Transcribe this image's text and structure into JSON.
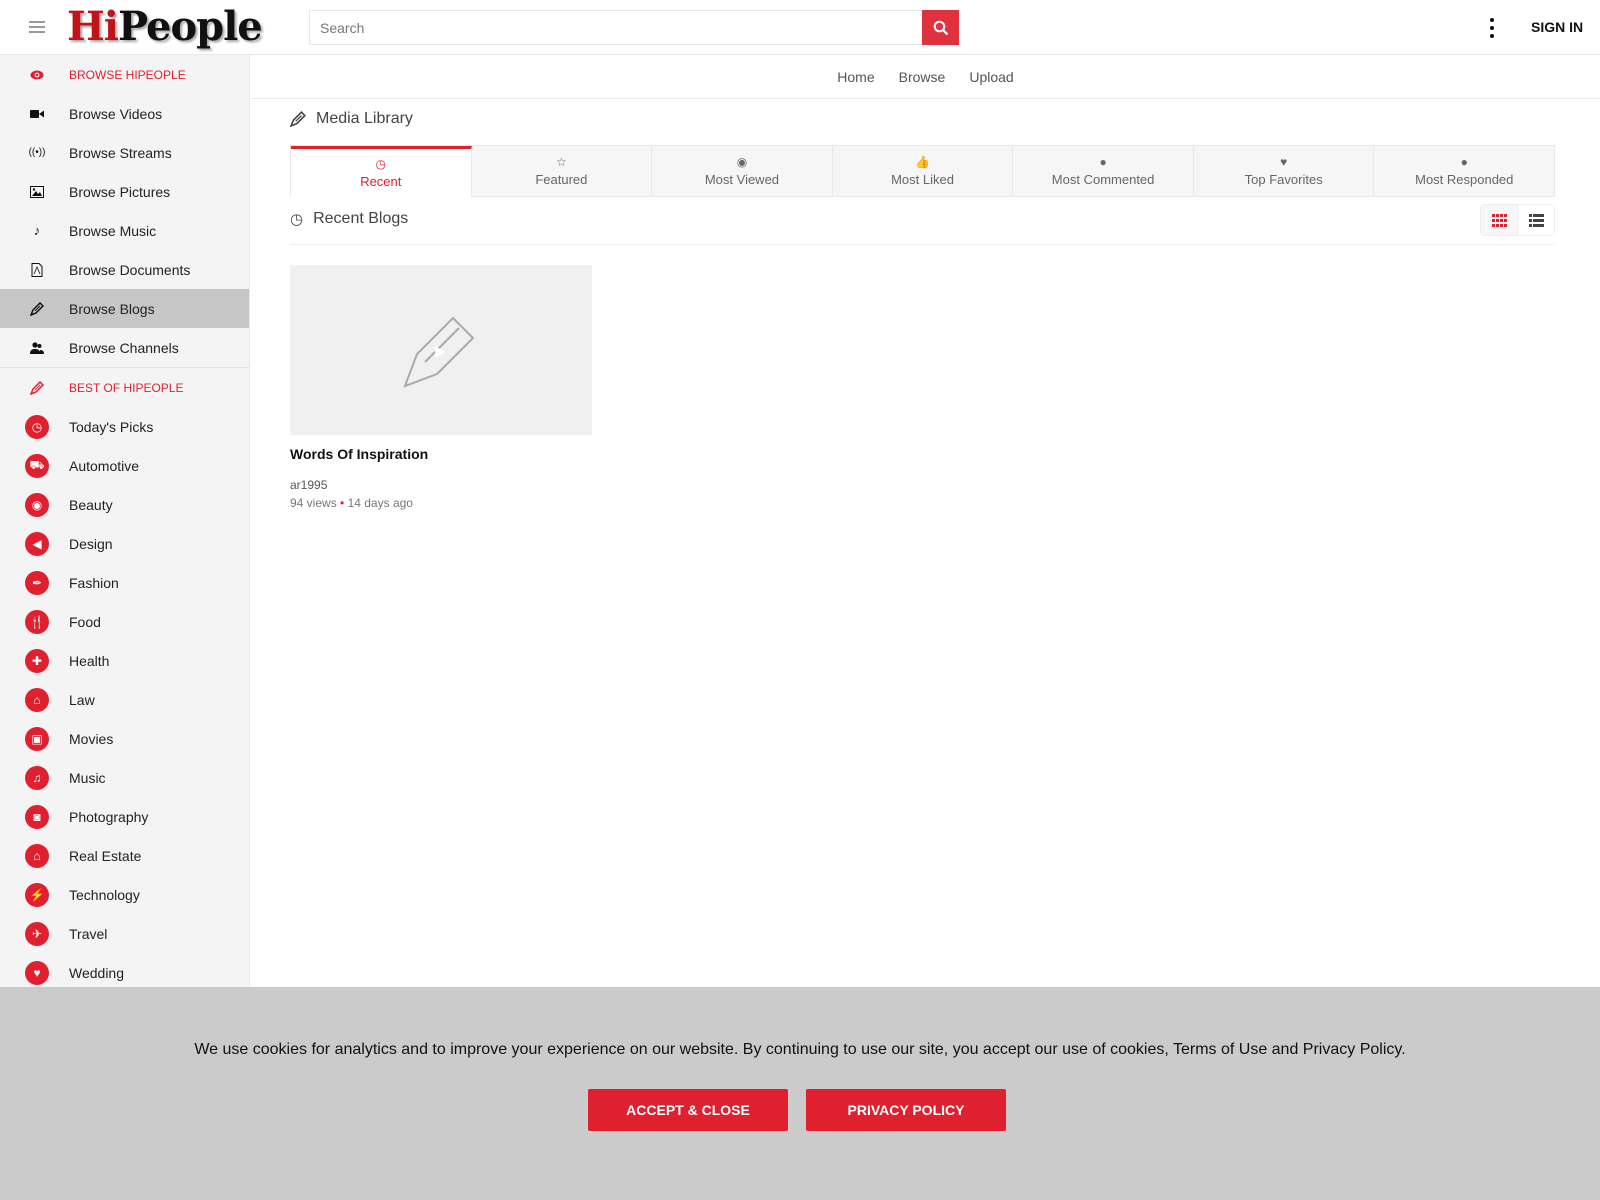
{
  "header": {
    "logo_hi": "Hi",
    "logo_people": "People",
    "search_placeholder": "Search",
    "signin_label": "SIGN IN"
  },
  "sidebar": {
    "browse_header": "BROWSE HIPEOPLE",
    "browse_items": [
      {
        "label": "Browse Videos",
        "icon": "video-icon"
      },
      {
        "label": "Browse Streams",
        "icon": "broadcast-icon"
      },
      {
        "label": "Browse Pictures",
        "icon": "picture-icon"
      },
      {
        "label": "Browse Music",
        "icon": "music-note-icon"
      },
      {
        "label": "Browse Documents",
        "icon": "document-icon"
      },
      {
        "label": "Browse Blogs",
        "icon": "pencil-icon",
        "active": true
      },
      {
        "label": "Browse Channels",
        "icon": "users-icon"
      }
    ],
    "best_header": "BEST OF HIPEOPLE",
    "categories": [
      {
        "label": "Today's Picks",
        "icon": "clock-icon"
      },
      {
        "label": "Automotive",
        "icon": "truck-icon"
      },
      {
        "label": "Beauty",
        "icon": "eye-icon"
      },
      {
        "label": "Design",
        "icon": "design-icon"
      },
      {
        "label": "Fashion",
        "icon": "feather-icon"
      },
      {
        "label": "Food",
        "icon": "cutlery-icon"
      },
      {
        "label": "Health",
        "icon": "medkit-icon"
      },
      {
        "label": "Law",
        "icon": "bank-icon"
      },
      {
        "label": "Movies",
        "icon": "film-icon"
      },
      {
        "label": "Music",
        "icon": "music-icon"
      },
      {
        "label": "Photography",
        "icon": "camera-icon"
      },
      {
        "label": "Real Estate",
        "icon": "home-icon"
      },
      {
        "label": "Technology",
        "icon": "plug-icon"
      },
      {
        "label": "Travel",
        "icon": "plane-icon"
      },
      {
        "label": "Wedding",
        "icon": "heart-icon"
      }
    ]
  },
  "subnav": [
    "Home",
    "Browse",
    "Upload"
  ],
  "main": {
    "title": "Media Library",
    "tabs": [
      {
        "label": "Recent",
        "icon": "clock-icon",
        "active": true
      },
      {
        "label": "Featured",
        "icon": "star-icon"
      },
      {
        "label": "Most Viewed",
        "icon": "eye-icon"
      },
      {
        "label": "Most Liked",
        "icon": "thumbs-up-icon"
      },
      {
        "label": "Most Commented",
        "icon": "comment-icon"
      },
      {
        "label": "Top Favorites",
        "icon": "heart-icon"
      },
      {
        "label": "Most Responded",
        "icon": "comments-icon"
      }
    ],
    "section_title": "Recent Blogs",
    "view_mode": "grid",
    "items": [
      {
        "title": "Words Of Inspiration",
        "author": "ar1995",
        "views": "94 views",
        "separator": "•",
        "age": "14 days ago"
      }
    ]
  },
  "cookie": {
    "text": "We use cookies for analytics and to improve your experience on our website. By continuing to use our site, you accept our use of cookies, Terms of Use and Privacy Policy.",
    "accept_label": "Accept & Close",
    "privacy_label": "Privacy Policy"
  },
  "colors": {
    "accent": "#e01f2f",
    "active_sidebar": "#c6c6c6",
    "cookie_bg": "#cbcbcb"
  }
}
